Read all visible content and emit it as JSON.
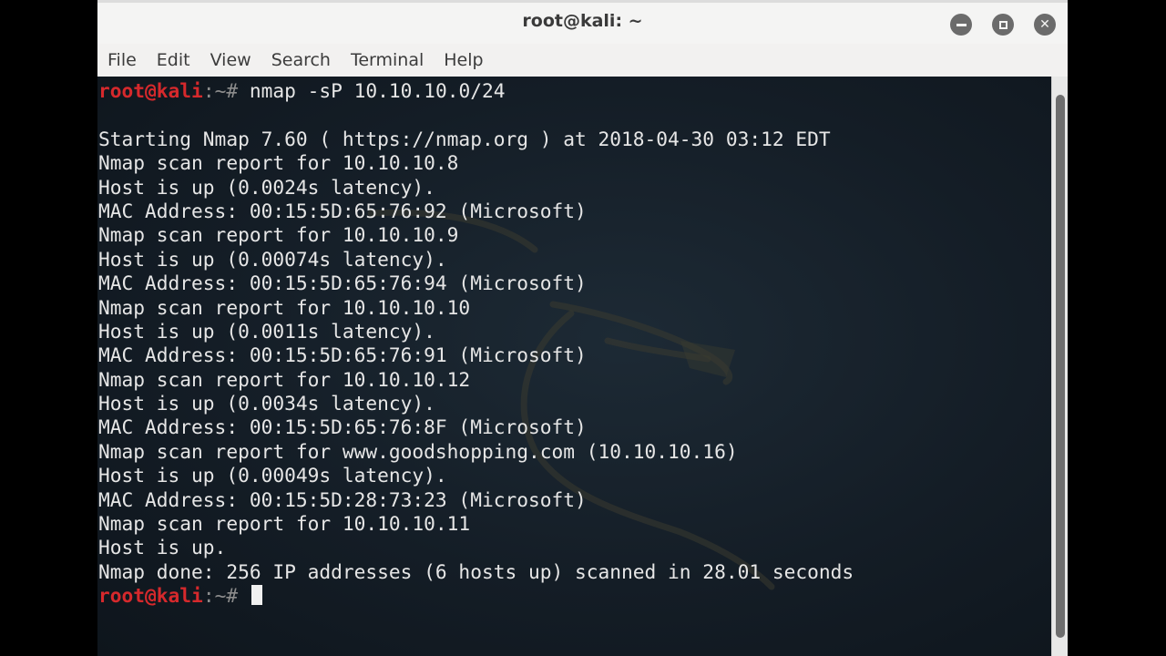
{
  "window": {
    "title": "root@kali: ~"
  },
  "menubar": {
    "items": [
      "File",
      "Edit",
      "View",
      "Search",
      "Terminal",
      "Help"
    ]
  },
  "terminal": {
    "prompt_user": "root@kali",
    "prompt_path": ":~# ",
    "command": "nmap -sP 10.10.10.0/24",
    "output": [
      "",
      "Starting Nmap 7.60 ( https://nmap.org ) at 2018-04-30 03:12 EDT",
      "Nmap scan report for 10.10.10.8",
      "Host is up (0.0024s latency).",
      "MAC Address: 00:15:5D:65:76:92 (Microsoft)",
      "Nmap scan report for 10.10.10.9",
      "Host is up (0.00074s latency).",
      "MAC Address: 00:15:5D:65:76:94 (Microsoft)",
      "Nmap scan report for 10.10.10.10",
      "Host is up (0.0011s latency).",
      "MAC Address: 00:15:5D:65:76:91 (Microsoft)",
      "Nmap scan report for 10.10.10.12",
      "Host is up (0.0034s latency).",
      "MAC Address: 00:15:5D:65:76:8F (Microsoft)",
      "Nmap scan report for www.goodshopping.com (10.10.10.16)",
      "Host is up (0.00049s latency).",
      "MAC Address: 00:15:5D:28:73:23 (Microsoft)",
      "Nmap scan report for 10.10.10.11",
      "Host is up.",
      "Nmap done: 256 IP addresses (6 hosts up) scanned in 28.01 seconds"
    ]
  },
  "colors": {
    "prompt_user": "#d6292c",
    "terminal_bg": "#141d26",
    "terminal_fg": "#e6e6e6"
  }
}
